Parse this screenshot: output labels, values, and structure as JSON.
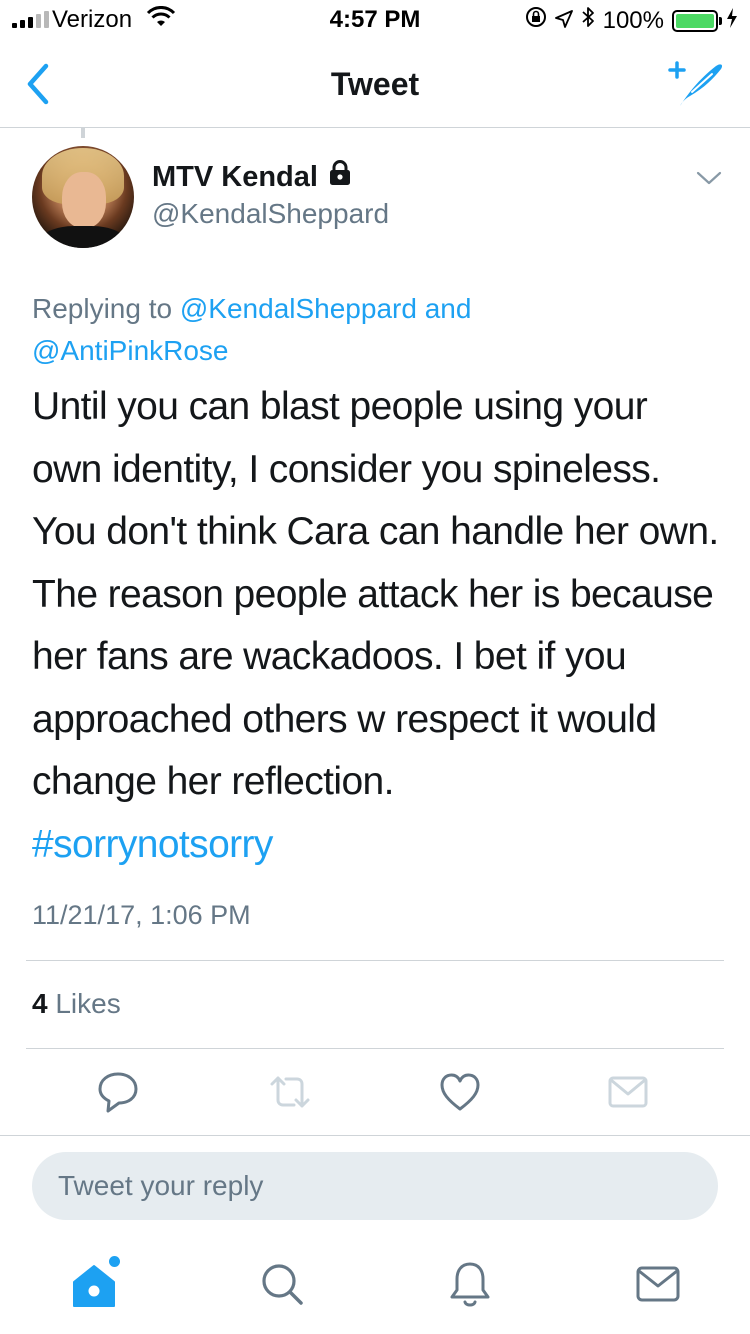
{
  "status_bar": {
    "carrier": "Verizon",
    "time": "4:57 PM",
    "battery_percent": "100%"
  },
  "nav": {
    "title": "Tweet"
  },
  "tweet": {
    "author": {
      "display_name": "MTV Kendal",
      "handle": "@KendalSheppard"
    },
    "replying_prefix": "Replying to ",
    "mentions": [
      "@KendalSheppard",
      "@AntiPinkRose"
    ],
    "mention_joiner": " and",
    "text": "Until you can blast people using your own identity, I consider you spineless. You don't think Cara can handle her own. The reason people attack her is because her fans are wackadoos. I bet if you approached others w respect it would change her reflection.",
    "hashtag": "#sorrynotsorry",
    "timestamp": "11/21/17, 1:06 PM",
    "likes_count": "4",
    "likes_label": " Likes"
  },
  "reply_box": {
    "placeholder": "Tweet your reply"
  },
  "icons": {
    "back": "chevron-left-icon",
    "compose": "compose-tweet-icon",
    "verified_lock": "lock-icon",
    "caret": "chevron-down-icon",
    "actions": [
      "reply-icon",
      "retweet-icon",
      "like-icon",
      "direct-message-icon"
    ],
    "tabs": [
      "home-icon",
      "search-icon",
      "notifications-icon",
      "messages-icon"
    ]
  },
  "colors": {
    "accent": "#1da1f2",
    "secondary_text": "#657786",
    "divider": "#cfd4d8",
    "disabled_icon": "#ccd6dd",
    "battery": "#4cd964"
  }
}
